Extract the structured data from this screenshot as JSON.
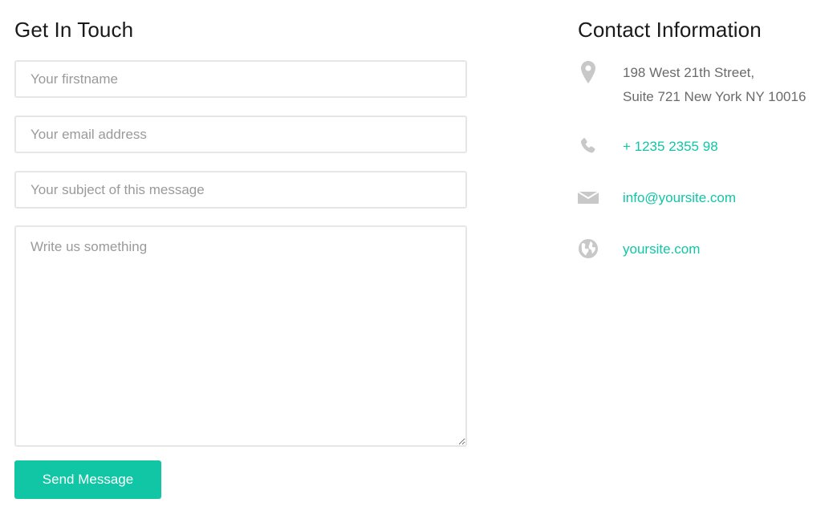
{
  "form": {
    "heading": "Get In Touch",
    "firstname_placeholder": "Your firstname",
    "email_placeholder": "Your email address",
    "subject_placeholder": "Your subject of this message",
    "message_placeholder": "Write us something",
    "submit_label": "Send Message"
  },
  "contact": {
    "heading": "Contact Information",
    "address_line1": "198 West 21th Street,",
    "address_line2": "Suite 721 New York NY 10016",
    "phone": "+ 1235 2355 98",
    "email": "info@yoursite.com",
    "website": "yoursite.com"
  },
  "icons": {
    "address": "location-pin-icon",
    "phone": "phone-icon",
    "email": "envelope-icon",
    "website": "globe-icon"
  },
  "colors": {
    "accent": "#10c6a5",
    "icon": "#c8c8c8",
    "border": "#e6e6e6"
  }
}
